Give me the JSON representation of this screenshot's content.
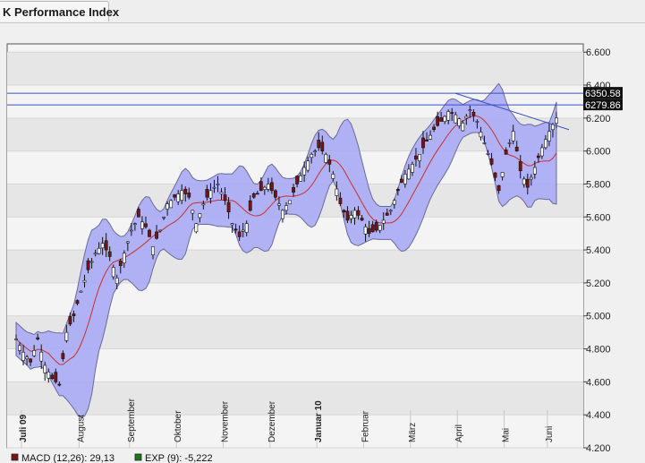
{
  "tab": {
    "title": "K Performance Index"
  },
  "chart_data": {
    "type": "candlestick",
    "y_ticks": [
      "6.600",
      "6.400",
      "6.200",
      "6.000",
      "5.800",
      "5.600",
      "5.400",
      "5.200",
      "5.000",
      "4.800",
      "4.600",
      "4.400",
      "4.200"
    ],
    "ylim": [
      4200,
      6650
    ],
    "x_months": [
      "Juli 09",
      "August",
      "September",
      "Oktober",
      "November",
      "Dezember",
      "Januar 10",
      "Februar",
      "März",
      "April",
      "Mai",
      "Juni"
    ],
    "price_labels": [
      "6350.58",
      "6279.86"
    ],
    "price_levels": [
      6350.58,
      6279.86
    ],
    "close_path": [
      [
        0,
        4860
      ],
      [
        2,
        4780
      ],
      [
        4,
        4720
      ],
      [
        6,
        4860
      ],
      [
        8,
        4700
      ],
      [
        10,
        4620
      ],
      [
        12,
        4580
      ],
      [
        14,
        4900
      ],
      [
        16,
        5000
      ],
      [
        18,
        5150
      ],
      [
        20,
        5280
      ],
      [
        22,
        5380
      ],
      [
        24,
        5440
      ],
      [
        26,
        5360
      ],
      [
        28,
        5230
      ],
      [
        30,
        5380
      ],
      [
        32,
        5520
      ],
      [
        34,
        5600
      ],
      [
        36,
        5540
      ],
      [
        38,
        5420
      ],
      [
        40,
        5520
      ],
      [
        42,
        5680
      ],
      [
        44,
        5720
      ],
      [
        46,
        5760
      ],
      [
        48,
        5720
      ],
      [
        50,
        5560
      ],
      [
        52,
        5680
      ],
      [
        54,
        5760
      ],
      [
        56,
        5800
      ],
      [
        58,
        5700
      ],
      [
        60,
        5560
      ],
      [
        62,
        5480
      ],
      [
        64,
        5560
      ],
      [
        66,
        5720
      ],
      [
        68,
        5760
      ],
      [
        70,
        5800
      ],
      [
        72,
        5720
      ],
      [
        74,
        5640
      ],
      [
        76,
        5700
      ],
      [
        78,
        5800
      ],
      [
        80,
        5900
      ],
      [
        82,
        5980
      ],
      [
        84,
        6020
      ],
      [
        86,
        5980
      ],
      [
        88,
        5860
      ],
      [
        90,
        5680
      ],
      [
        92,
        5580
      ],
      [
        94,
        5640
      ],
      [
        96,
        5580
      ],
      [
        98,
        5500
      ],
      [
        100,
        5520
      ],
      [
        102,
        5580
      ],
      [
        104,
        5640
      ],
      [
        106,
        5760
      ],
      [
        108,
        5860
      ],
      [
        110,
        5920
      ],
      [
        112,
        5980
      ],
      [
        114,
        6060
      ],
      [
        116,
        6130
      ],
      [
        118,
        6180
      ],
      [
        120,
        6240
      ],
      [
        122,
        6220
      ],
      [
        124,
        6170
      ],
      [
        126,
        6250
      ],
      [
        128,
        6180
      ],
      [
        130,
        6050
      ],
      [
        132,
        5920
      ],
      [
        134,
        5760
      ],
      [
        136,
        5980
      ],
      [
        138,
        6120
      ],
      [
        140,
        5880
      ],
      [
        142,
        5780
      ],
      [
        144,
        5900
      ],
      [
        146,
        6020
      ],
      [
        148,
        6120
      ],
      [
        150,
        6200
      ]
    ],
    "macd_label": "MACD (12,26): 29,13",
    "exp_label": "EXP (9): -5,222",
    "colors": {
      "band": "#aaaaf5",
      "ma": "#c83030",
      "candle_up": "#ffffff",
      "candle_down": "#7a1414",
      "level": "#3a50c8"
    }
  }
}
